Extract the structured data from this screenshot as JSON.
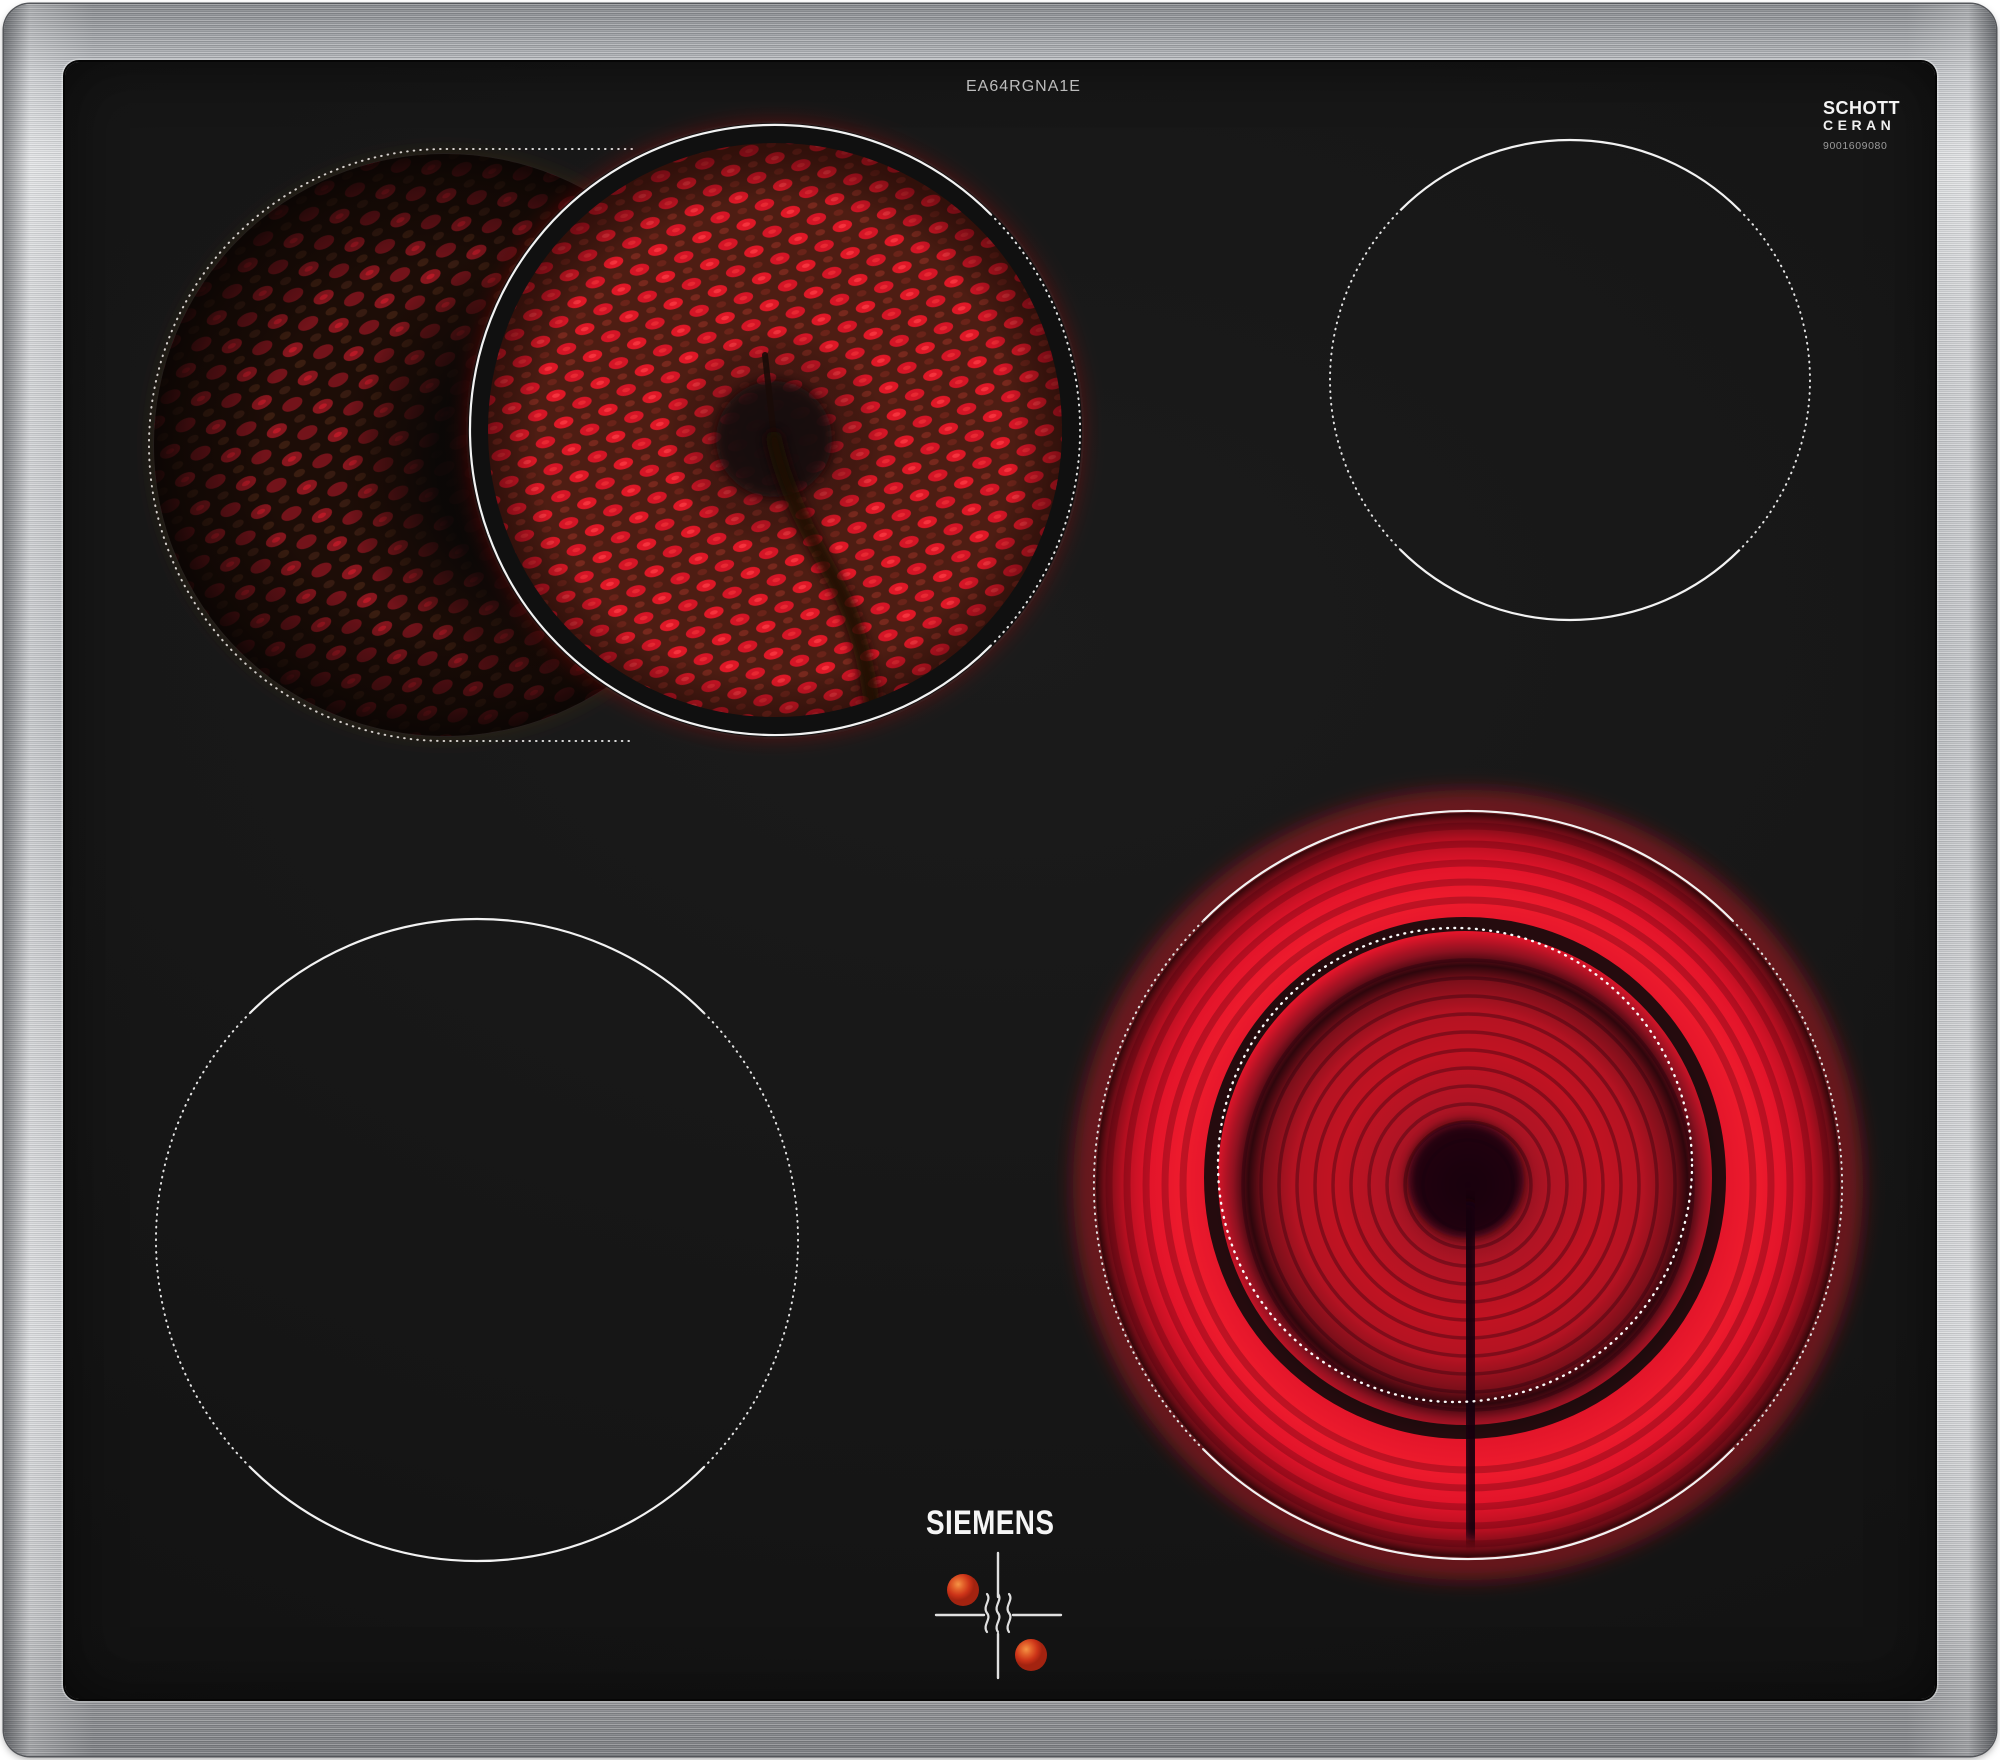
{
  "product": {
    "type": "ceramic glass electric hob, 4 radiant zones",
    "brand_logo": "SIEMENS",
    "model_number": "EA64RGNA1E",
    "glass_brand_line1": "SCHOTT",
    "glass_brand_line2": "CERAN",
    "glass_serial": "9001609080"
  },
  "zones": {
    "top_left": {
      "state": "on",
      "appearance": "dual radiant element glowing, dim crescent ring plus bright coil disc, dotted zone outline"
    },
    "top_right": {
      "state": "off",
      "appearance": "thin white circle outline, solid top and bottom arcs, dotted sides"
    },
    "bottom_left": {
      "state": "off",
      "appearance": "thin white circle outline, solid top and bottom arcs, dotted sides"
    },
    "bottom_right": {
      "state": "on",
      "appearance": "bright red glowing ring with darker spiral inner disc, dotted inner circle, sensor stem shadow"
    }
  },
  "indicator": {
    "description": "hotplate position cross with residual heat wave icon and two glowing hot-surface dots",
    "hot_dots": [
      "upper-left quadrant",
      "lower-right quadrant"
    ]
  },
  "colors": {
    "frame_metal": "#b9bbbe",
    "glass_black": "#151515",
    "zone_outline_white": "#f2f2f2",
    "element_bright_red": "#e01627",
    "element_dim_red": "#8e1620",
    "ring_bright_red": "#ee1b2d",
    "indicator_dot_orange": "#e05a26"
  }
}
